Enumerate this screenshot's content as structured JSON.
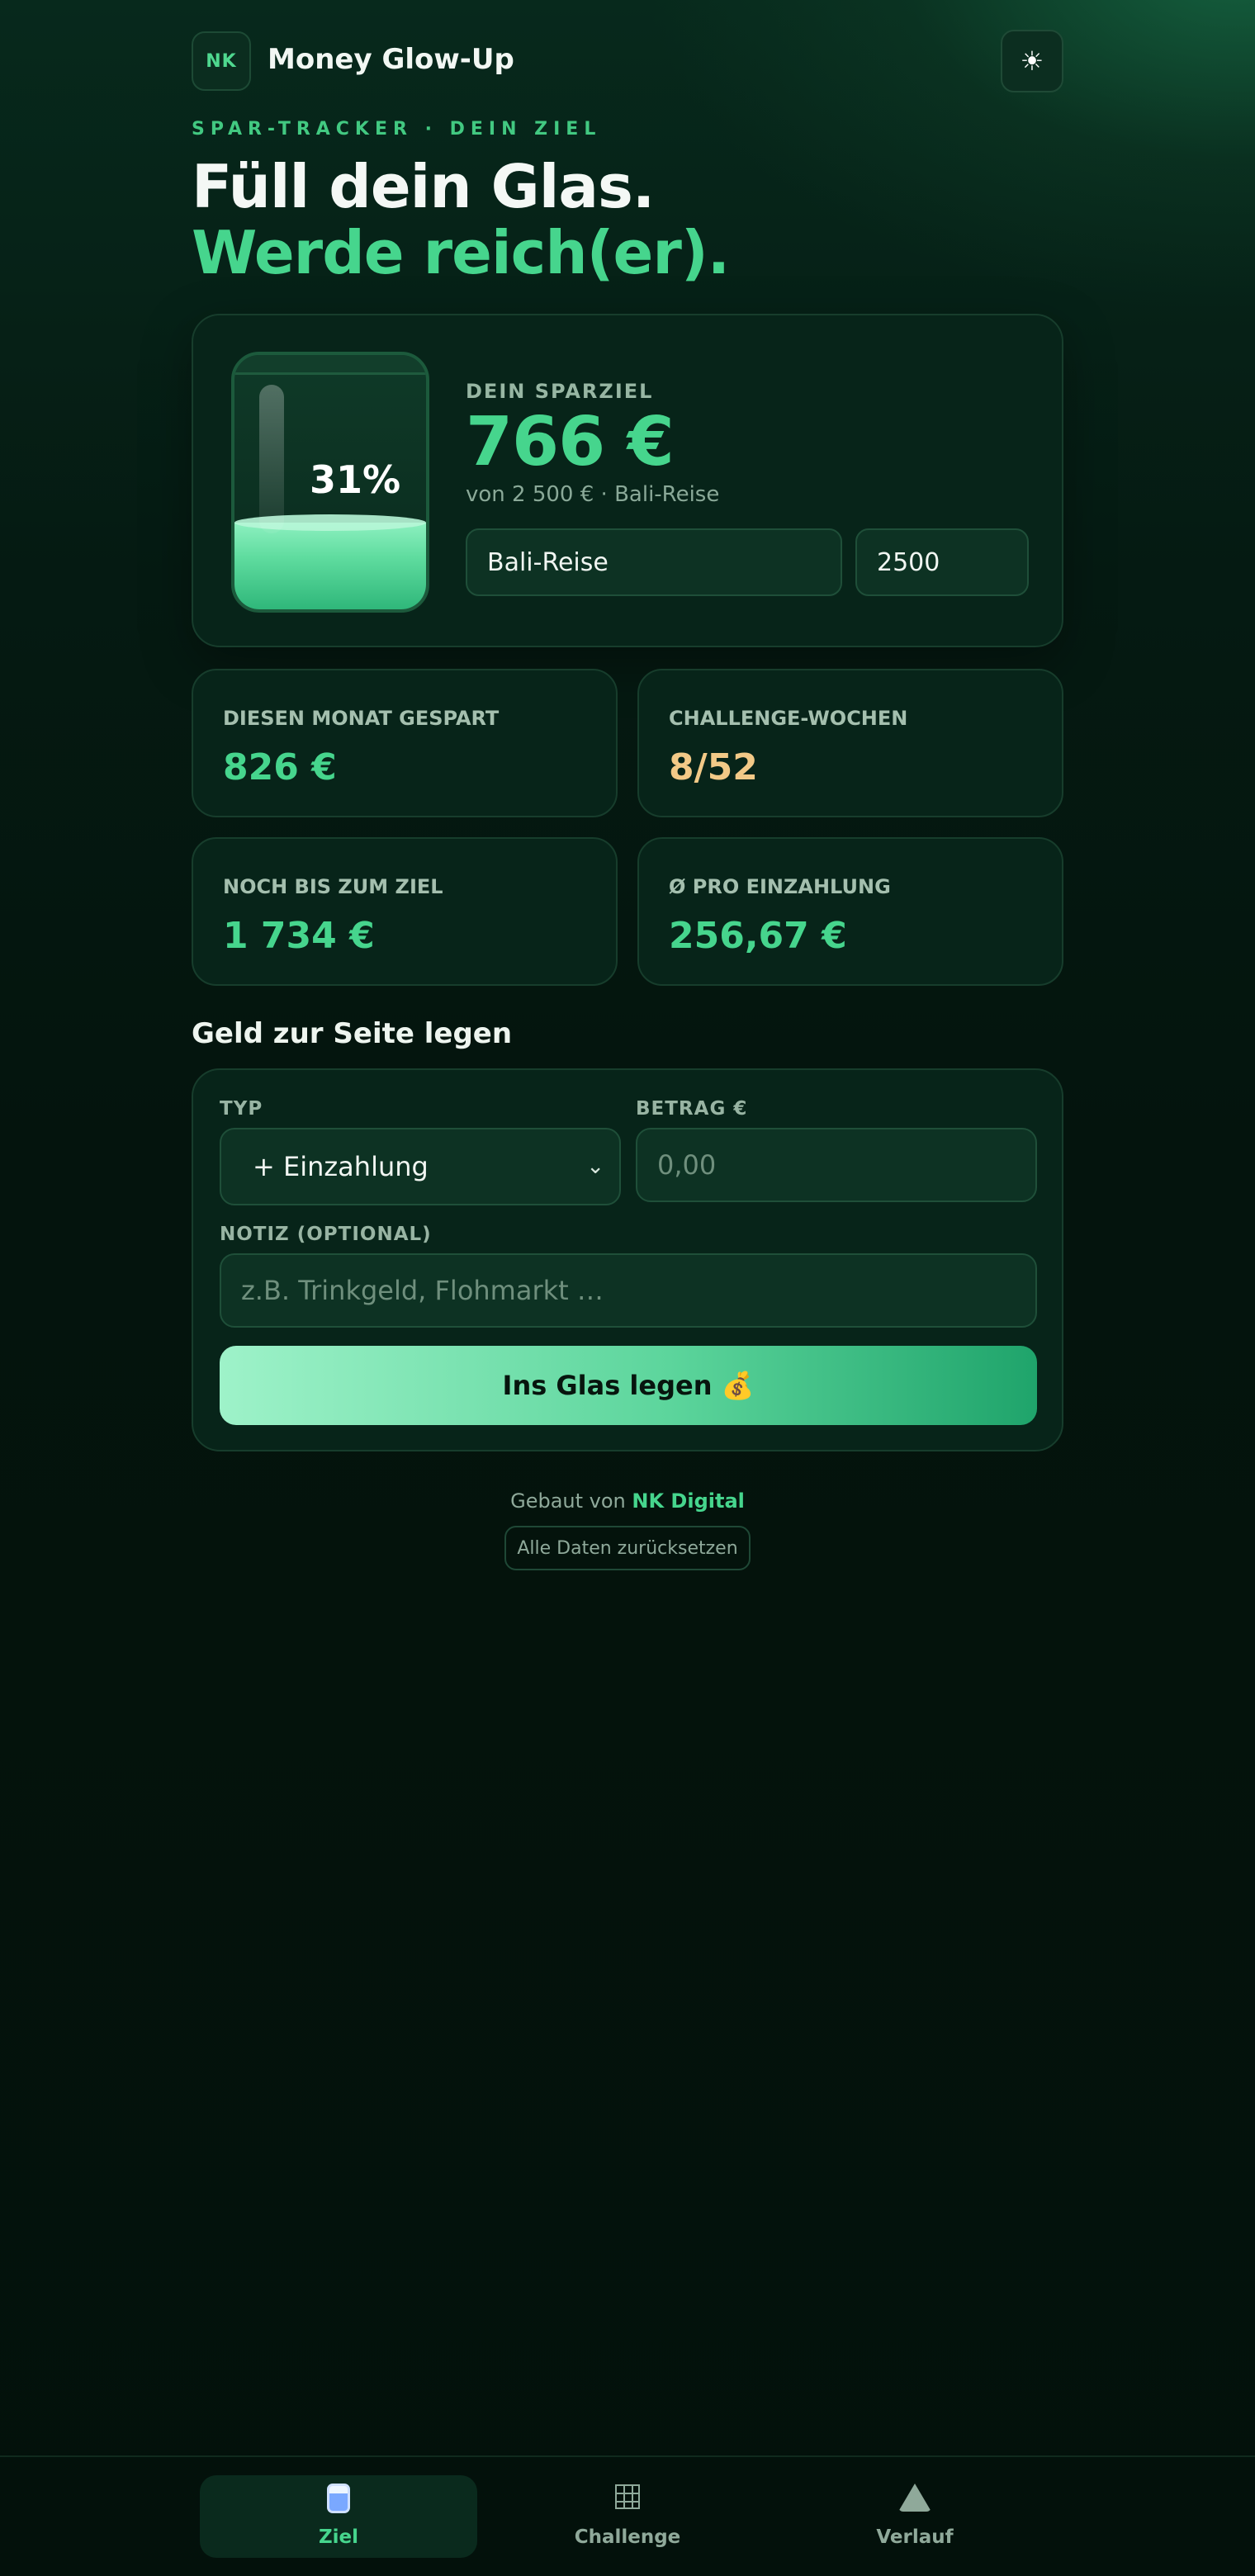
{
  "header": {
    "logo": "NK",
    "title": "Money Glow-Up",
    "theme_icon": "sun-icon",
    "theme_glyph": "☀"
  },
  "hero": {
    "eyebrow": "SPAR-TRACKER · DEIN ZIEL",
    "line1": "Füll dein Glas.",
    "line2": "Werde reich(er)."
  },
  "goal": {
    "jar_percent_label": "31%",
    "fill_fraction": 0.31,
    "label": "DEIN SPARZIEL",
    "amount": "766 €",
    "subtitle": "von 2 500 € · Bali-Reise",
    "name_value": "Bali-Reise",
    "target_value": "2500"
  },
  "stats": [
    {
      "label": "DIESEN MONAT GESPART",
      "value": "826 €",
      "color": "#46d58d"
    },
    {
      "label": "CHALLENGE-WOCHEN",
      "value": "8/52",
      "color": "#f2c987"
    },
    {
      "label": "NOCH BIS ZUM ZIEL",
      "value": "1 734 €",
      "color": "#46d58d"
    },
    {
      "label": "Ø PRO EINZAHLUNG",
      "value": "256,67 €",
      "color": "#46d58d"
    }
  ],
  "deposit": {
    "section_title": "Geld zur Seite legen",
    "type_label": "TYP",
    "type_value": "+ Einzahlung",
    "amount_label": "BETRAG €",
    "amount_placeholder": "0,00",
    "note_label": "NOTIZ (OPTIONAL)",
    "note_placeholder": "z.B. Trinkgeld, Flohmarkt …",
    "submit_label": "Ins Glas legen 💰"
  },
  "footer": {
    "credit_prefix": "Gebaut von",
    "credit_brand": "NK Digital",
    "reset_label": "Alle Daten zurücksetzen"
  },
  "nav": {
    "items": [
      {
        "label": "Ziel",
        "icon": "jar-icon",
        "active": true
      },
      {
        "label": "Challenge",
        "icon": "grid-icon",
        "active": false
      },
      {
        "label": "Verlauf",
        "icon": "mountain-icon",
        "active": false
      }
    ]
  },
  "colors": {
    "accent": "#46d58d",
    "gold": "#f2c987",
    "background": "#04140d"
  }
}
